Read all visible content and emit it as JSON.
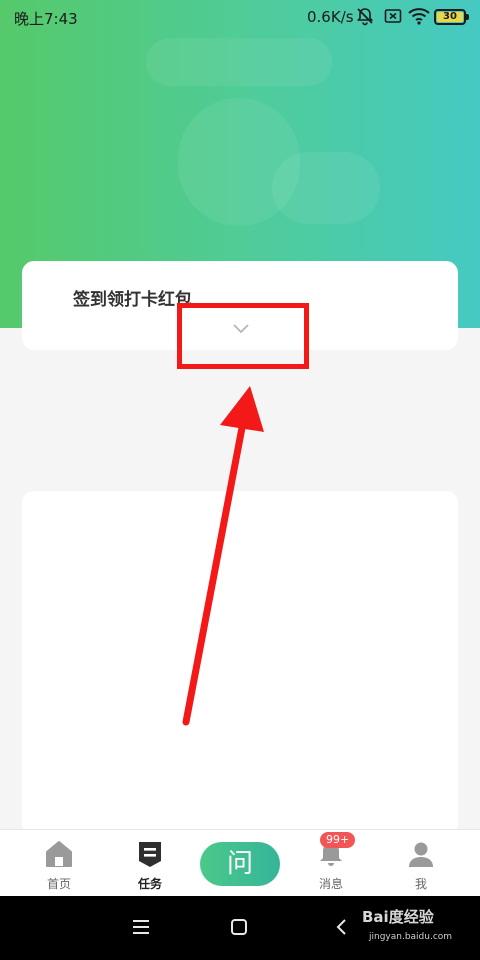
{
  "status_bar": {
    "time": "晚上7:43",
    "network_speed": "0.6K/s",
    "battery_level": "30",
    "icons": [
      "bell-off-icon",
      "sim-x-icon",
      "wifi-icon",
      "battery-icon"
    ]
  },
  "checkin_card": {
    "title": "签到领打卡红包",
    "expand_icon": "chevron-down-icon"
  },
  "annotation": {
    "box_color": "#f41919",
    "arrow_color": "#f41919"
  },
  "bottom_nav": {
    "items": [
      {
        "label": "首页",
        "icon": "home-icon"
      },
      {
        "label": "任务",
        "icon": "task-icon",
        "active": true
      },
      {
        "label": "问",
        "icon": "ask-button"
      },
      {
        "label": "消息",
        "icon": "bell-icon",
        "badge": "99+"
      },
      {
        "label": "我",
        "icon": "profile-icon"
      }
    ]
  },
  "system_nav": {
    "icons": [
      "menu-icon",
      "home-square-icon",
      "back-icon"
    ],
    "watermark": "Bai度经验",
    "watermark_url": "jingyan.baidu.com"
  },
  "colors": {
    "hero_start": "#55c96a",
    "hero_end": "#45c9c2",
    "accent": "#3cbf93",
    "badge": "#f25555"
  }
}
